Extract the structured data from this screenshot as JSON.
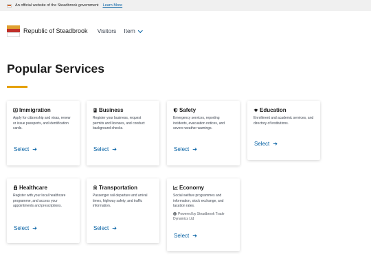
{
  "banner": {
    "text": "An official website of the Steadbrook government",
    "link": "Learn More"
  },
  "header": {
    "site_name": "Republic of Steadbrook",
    "nav": [
      {
        "label": "Visitors"
      },
      {
        "label": "Item"
      }
    ]
  },
  "page": {
    "title": "Popular Services"
  },
  "colors": {
    "accent": "#e5a000",
    "link": "#005ea2",
    "flag_top": "#e0a030",
    "flag_middle": "#c0302a",
    "flag_bottom": "#ffffff"
  },
  "services": [
    {
      "icon": "id-card-icon",
      "title": "Immigration",
      "description": "Apply for citizenship and visas, renew or issue passports, and identification cards.",
      "action": "Select"
    },
    {
      "icon": "building-icon",
      "title": "Business",
      "description": "Register your business, request permits and licenses, and conduct background checks.",
      "action": "Select"
    },
    {
      "icon": "shield-icon",
      "title": "Safety",
      "description": "Emergency services, reporting incidents, evacuation notices, and severe weather warnings.",
      "action": "Select"
    },
    {
      "icon": "graduation-cap-icon",
      "title": "Education",
      "description": "Enrollment and academic services, and directory of institutions.",
      "action": "Select"
    },
    {
      "icon": "medical-kit-icon",
      "title": "Healthcare",
      "description": "Register with your local healthcare programme, and access your appointments and prescriptions.",
      "action": "Select"
    },
    {
      "icon": "train-icon",
      "title": "Transportation",
      "description": "Passenger rail departure and arrival times, highway safety, and traffic information.",
      "action": "Select"
    },
    {
      "icon": "line-chart-icon",
      "title": "Economy",
      "description": "Social welfare programmes and information, stock exchange, and taxation rates.",
      "powered_by": "Powered by Steadbrook Trade Dynamics Ltd",
      "action": "Select"
    }
  ]
}
